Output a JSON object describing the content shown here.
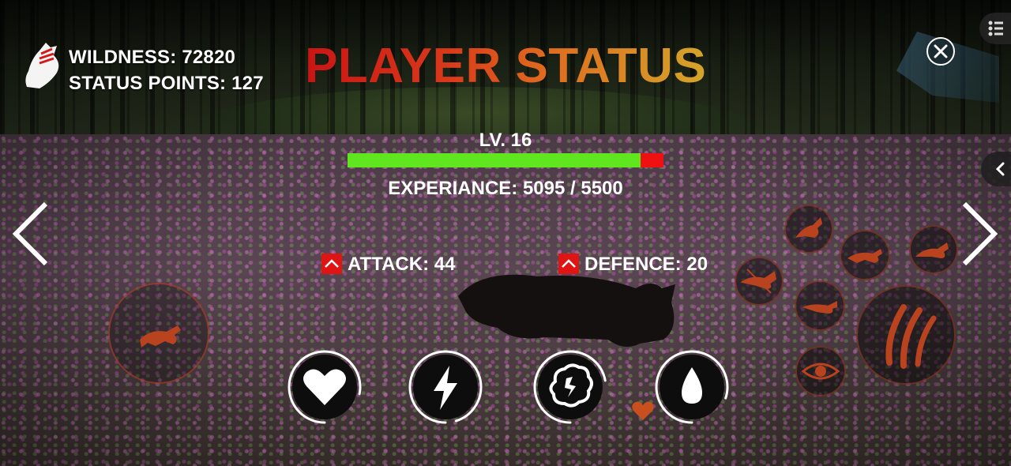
{
  "hud": {
    "wildness_label": "WILDNESS: 72820",
    "status_points_label": "STATUS POINTS: 127",
    "title": "PLAYER STATUS",
    "level_label": "LV. 16",
    "experience_label": "EXPERIANCE: 5095 / 5500",
    "experience_current": 5095,
    "experience_max": 5500,
    "attack_label": "ATTACK: 44",
    "defence_label": "DEFENCE: 20"
  },
  "colors": {
    "xp_fill": "#5fe61e",
    "xp_empty": "#ee1111",
    "upgrade_button": "#e11414",
    "title_gradient_start": "#c81515",
    "title_gradient_end": "#d4a52a"
  },
  "icons": {
    "logo": "wolf-claw-logo-icon",
    "close": "close-icon",
    "menu": "list-menu-icon",
    "side_tab": "chevron-left-icon",
    "prev": "chevron-left-icon",
    "next": "chevron-right-icon",
    "upgrade": "chevron-up-icon",
    "meters": [
      "heart-icon",
      "lightning-icon",
      "brain-icon",
      "water-drop-icon"
    ],
    "skills": [
      "wolf-howl-icon",
      "wolf-run-icon",
      "wolf-leap-icon",
      "wolf-bite-icon",
      "wolf-sneak-icon",
      "claw-attack-icon",
      "eye-icon"
    ]
  },
  "meters": [
    {
      "name": "health",
      "level": 0.78
    },
    {
      "name": "energy",
      "level": 0.95
    },
    {
      "name": "mind",
      "level": 0.72
    },
    {
      "name": "water",
      "level": 0.8
    }
  ]
}
